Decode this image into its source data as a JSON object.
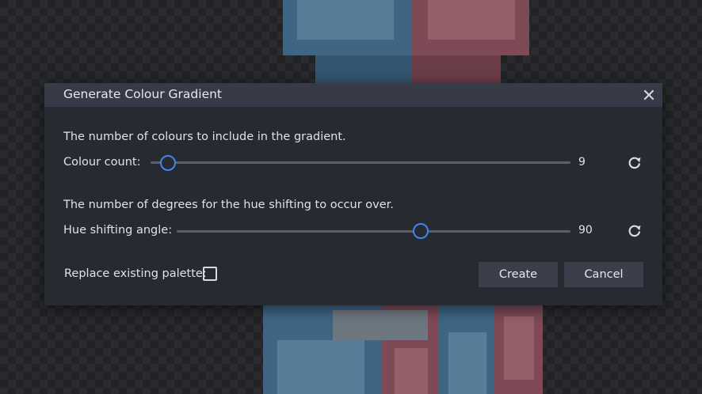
{
  "dialog": {
    "title": "Generate Colour Gradient",
    "colour_count": {
      "description": "The number of colours to include in the gradient.",
      "label": "Colour count:",
      "value": "9"
    },
    "hue_shift": {
      "description": "The number of degrees for the hue shifting to occur over.",
      "label": "Hue shifting angle:",
      "value": "90"
    },
    "replace_palette": {
      "label": "Replace existing palette:",
      "checked": false
    },
    "buttons": {
      "create": "Create",
      "cancel": "Cancel"
    }
  },
  "colors": {
    "accent": "#3b86f0",
    "dialog_bg": "#282a31",
    "titlebar_bg": "#373b47",
    "button_bg": "#3a3f4b"
  },
  "icons": {
    "close": "close-icon",
    "reset": "reset-icon"
  }
}
